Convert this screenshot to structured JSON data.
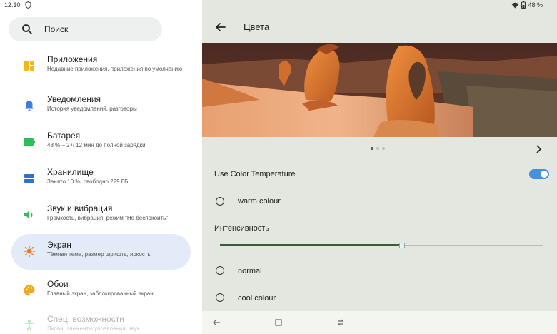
{
  "status": {
    "time": "12:10",
    "battery": "48 %"
  },
  "search": {
    "label": "Поиск"
  },
  "settings_list": [
    {
      "title": "Приложения",
      "subtitle": "Недавние приложения, приложения по умолчанию"
    },
    {
      "title": "Уведомления",
      "subtitle": "История уведомлений, разговоры"
    },
    {
      "title": "Батарея",
      "subtitle": "48 % – 2 ч 12 мин до полной зарядки"
    },
    {
      "title": "Хранилище",
      "subtitle": "Занято 10 %, свободно 229 ГБ"
    },
    {
      "title": "Звук и вибрация",
      "subtitle": "Громкость, вибрация, режим \"Не беспокоить\""
    },
    {
      "title": "Экран",
      "subtitle": "Тёмная тема, размер шрифта, яркость"
    },
    {
      "title": "Обои",
      "subtitle": "Главный экран, заблокированный экран"
    },
    {
      "title": "Спец. возможности",
      "subtitle": "Экран, элементы управления, звук"
    }
  ],
  "detail": {
    "title": "Цвета",
    "use_color_temp": "Use Color Temperature",
    "use_color_temp_on": true,
    "warm": "warm colour",
    "intensity": "Интенсивность",
    "intensity_value": 0.56,
    "normal": "normal",
    "cool": "cool colour"
  },
  "colors": {
    "accent_blue": "#4a8ee0",
    "active_bg": "#e3eaf8",
    "slider_green": "#3c5c3a"
  }
}
